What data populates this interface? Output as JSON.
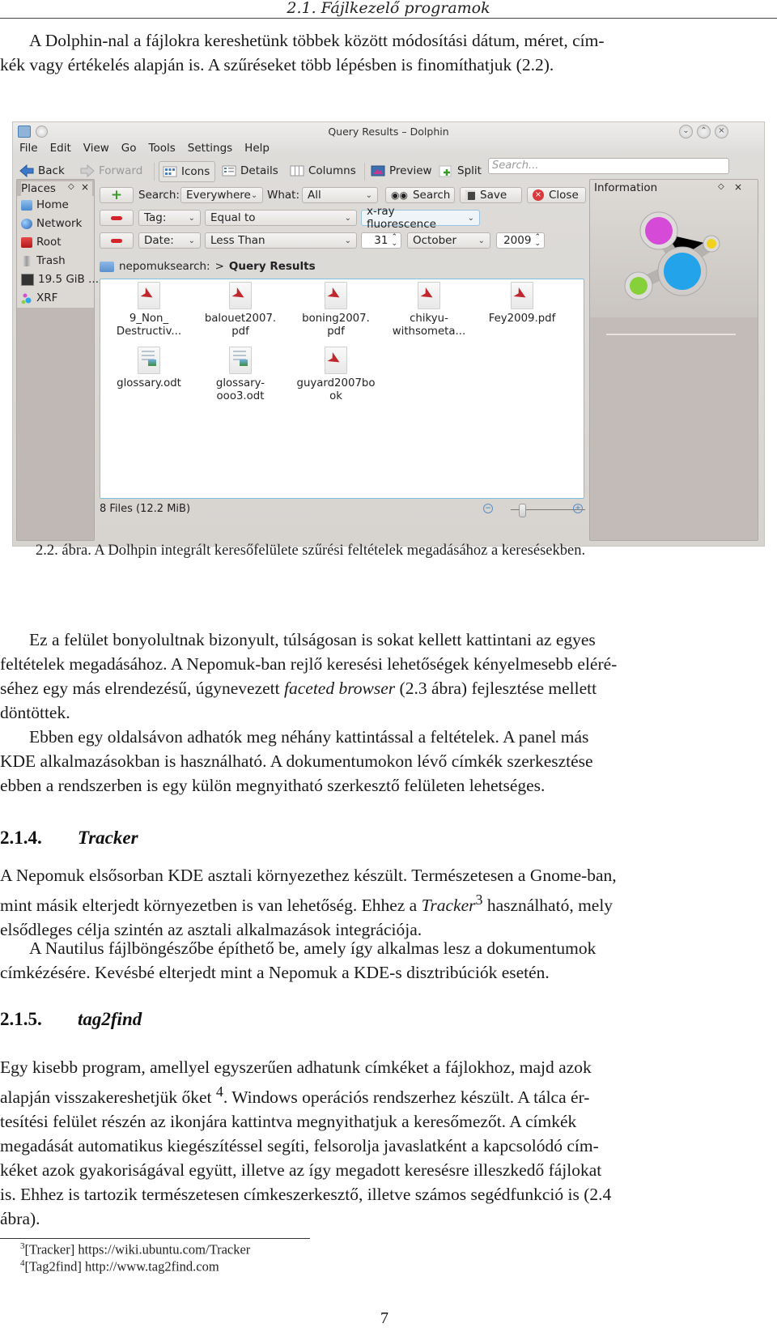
{
  "running_header": "2.1. Fájlkezelő programok",
  "intro_paragraph": [
    "A Dolphin-nal a fájlokra kereshetünk többek között módosítási dátum, méret, cím-",
    "kék vagy értékelés alapján is. A szűréseket több lépésben is finomíthatjuk (2.2)."
  ],
  "figure": {
    "window": {
      "title": "Query Results – Dolphin",
      "menu": [
        "File",
        "Edit",
        "View",
        "Go",
        "Tools",
        "Settings",
        "Help"
      ],
      "toolbar": {
        "back": "Back",
        "forward": "Forward",
        "icons": "Icons",
        "details": "Details",
        "columns": "Columns",
        "preview": "Preview",
        "split": "Split",
        "search_placeholder": "Search..."
      },
      "places": {
        "title": "Places",
        "items": [
          {
            "label": "Home",
            "icon": "home-folder-icon"
          },
          {
            "label": "Network",
            "icon": "network-globe-icon"
          },
          {
            "label": "Root",
            "icon": "red-folder-icon"
          },
          {
            "label": "Trash",
            "icon": "trash-icon"
          },
          {
            "label": "19.5 GiB ...",
            "icon": "drive-icon"
          },
          {
            "label": "XRF",
            "icon": "nepomuk-icon"
          }
        ]
      },
      "filters": {
        "search_label": "Search:",
        "search_scope": "Everywhere",
        "what_label": "What:",
        "what_value": "All",
        "search_button": "Search",
        "save_button": "Save",
        "close_button": "Close",
        "tag_row": {
          "field": "Tag:",
          "operator": "Equal to",
          "value": "x-ray fluorescence"
        },
        "date_row": {
          "field": "Date:",
          "operator": "Less Than",
          "day": "31",
          "month": "October",
          "year": "2009"
        }
      },
      "breadcrumb": {
        "root": "nepomuksearch:",
        "separator": ">",
        "current": "Query Results"
      },
      "files": [
        {
          "name_line1": "9_Non_",
          "name_line2": "Destructiv...",
          "type": "pdf"
        },
        {
          "name_line1": "balouet2007.",
          "name_line2": "pdf",
          "type": "pdf"
        },
        {
          "name_line1": "boning2007.",
          "name_line2": "pdf",
          "type": "pdf"
        },
        {
          "name_line1": "chikyu-",
          "name_line2": "withsometa...",
          "type": "pdf"
        },
        {
          "name_line1": "Fey2009.pdf",
          "name_line2": "",
          "type": "pdf"
        },
        {
          "name_line1": "glossary.odt",
          "name_line2": "",
          "type": "odt"
        },
        {
          "name_line1": "glossary-",
          "name_line2": "ooo3.odt",
          "type": "odt"
        },
        {
          "name_line1": "guyard2007bo",
          "name_line2": "ok",
          "type": "pdf"
        }
      ],
      "status": "8 Files (12.2 MiB)",
      "zoom_level_fraction": 0.15,
      "information_panel": {
        "title": "Information"
      }
    },
    "caption": "2.2. ábra. A Dolhpin integrált keresőfelülete szűrési feltételek megadásához a keresésekben."
  },
  "paragraph2": [
    "Ez a felület bonyolultnak bizonyult, túlságosan is sokat kellett kattintani az egyes",
    "feltételek megadásához. A Nepomuk-ban rejlő keresési lehetőségek kényelmesebb eléré-",
    {
      "before": "séhez egy más elrendezésű, úgynevezett ",
      "italic": "faceted browser",
      "after": " (2.3 ábra) fejlesztése mellett"
    },
    "döntöttek."
  ],
  "paragraph3": [
    "Ebben egy oldalsávon adhatók meg néhány kattintással a feltételek. A panel más",
    "KDE alkalmazásokban is használható. A dokumentumokon lévő címkék szerkesztése",
    "ebben a rendszerben is egy külön megnyitható szerkesztő felületen lehetséges."
  ],
  "section_tracker": {
    "number": "2.1.4.",
    "title": "Tracker"
  },
  "tracker_paragraph1": {
    "line1": "A Nepomuk elsősorban KDE asztali környezethez készült. Természetesen a Gnome-ban,",
    "line2_before": "mint másik elterjedt környezetben is van lehetőség. Ehhez a ",
    "line2_italic": "Tracker",
    "line2_sup": "3",
    "line2_after": " használható, mely",
    "line3": "elsődleges célja szintén az asztali alkalmazások integrációja."
  },
  "tracker_paragraph2": [
    "A Nautilus fájlböngészőbe építhető be, amely így alkalmas lesz a dokumentumok",
    "címkézésére. Kevésbé elterjedt mint a Nepomuk a KDE-s disztribúciók esetén."
  ],
  "section_tag2find": {
    "number": "2.1.5.",
    "title": "tag2find"
  },
  "tag2find_paragraph": {
    "line1": "Egy kisebb program, amellyel egyszerűen adhatunk címkéket a fájlokhoz, majd azok",
    "line2_before": "alapján visszakereshetjük őket ",
    "line2_sup": "4",
    "line2_after": ". Windows operációs rendszerhez készült. A tálca ér-",
    "line3": "tesítési felület részén az ikonjára kattintva megnyithatjuk a keresőmezőt. A címkék",
    "line4": "megadását automatikus kiegészítéssel segíti, felsorolja javaslatként a kapcsolódó cím-",
    "line5": "kéket azok gyakoriságával együtt, illetve az így megadott keresésre illeszkedő fájlokat",
    "line6": "is. Ehhez is tartozik természetesen címkeszerkesztő, illetve számos segédfunkció is (2.4",
    "line7": "ábra)."
  },
  "footnotes": [
    {
      "mark": "3",
      "text": "[Tracker] https://wiki.ubuntu.com/Tracker"
    },
    {
      "mark": "4",
      "text": "[Tag2find] http://www.tag2find.com"
    }
  ],
  "page_number": "7"
}
